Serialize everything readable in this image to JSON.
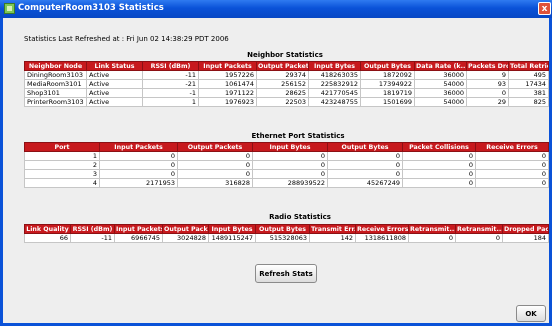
{
  "window": {
    "title": "ComputerRoom3103 Statistics",
    "close_glyph": "x"
  },
  "refreshed": "Statistics Last Refreshed at :  Fri Jun 02 14:38:29 PDT 2006",
  "neighbor": {
    "title": "Neighbor Statistics",
    "columns": [
      "Neighbor Node",
      "Link Status",
      "RSSI (dBm)",
      "Input Packets",
      "Output Packets",
      "Input Bytes",
      "Output Bytes",
      "Data Rate (k...",
      "Packets Drop...",
      "Total Retries"
    ],
    "rows": [
      [
        "DiningRoom3103",
        "Active",
        "-11",
        "1957226",
        "29374",
        "418263035",
        "1872092",
        "36000",
        "9",
        "495"
      ],
      [
        "MediaRoom3101",
        "Active",
        "-21",
        "1061474",
        "256152",
        "225832912",
        "17394922",
        "54000",
        "93",
        "17434"
      ],
      [
        "Shop3101",
        "Active",
        "-1",
        "1971122",
        "28625",
        "421770545",
        "1819719",
        "36000",
        "0",
        "381"
      ],
      [
        "PrinterRoom3103",
        "Active",
        "1",
        "1976923",
        "22503",
        "423248755",
        "1501699",
        "54000",
        "29",
        "825"
      ]
    ]
  },
  "ethernet": {
    "title": "Ethernet Port Statistics",
    "columns": [
      "Port",
      "Input Packets",
      "Output Packets",
      "Input Bytes",
      "Output Bytes",
      "Packet Collisions",
      "Receive Errors"
    ],
    "rows": [
      [
        "1",
        "0",
        "0",
        "0",
        "0",
        "0",
        "0"
      ],
      [
        "2",
        "0",
        "0",
        "0",
        "0",
        "0",
        "0"
      ],
      [
        "3",
        "0",
        "0",
        "0",
        "0",
        "0",
        "0"
      ],
      [
        "4",
        "2171953",
        "316828",
        "288939522",
        "45267249",
        "0",
        "0"
      ]
    ]
  },
  "radio": {
    "title": "Radio Statistics",
    "columns": [
      "Link Quality",
      "RSSI (dBm)",
      "Input Packets",
      "Output Pack...",
      "Input Bytes",
      "Output Bytes",
      "Transmit Err...",
      "Receive Errors",
      "Retransmit...",
      "Retransmit...",
      "Dropped Pac..."
    ],
    "rows": [
      [
        "66",
        "-11",
        "6966745",
        "3024828",
        "1489115247",
        "515328063",
        "142",
        "1318611808",
        "0",
        "0",
        "184"
      ]
    ]
  },
  "buttons": {
    "refresh": "Refresh Stats",
    "ok": "OK"
  }
}
